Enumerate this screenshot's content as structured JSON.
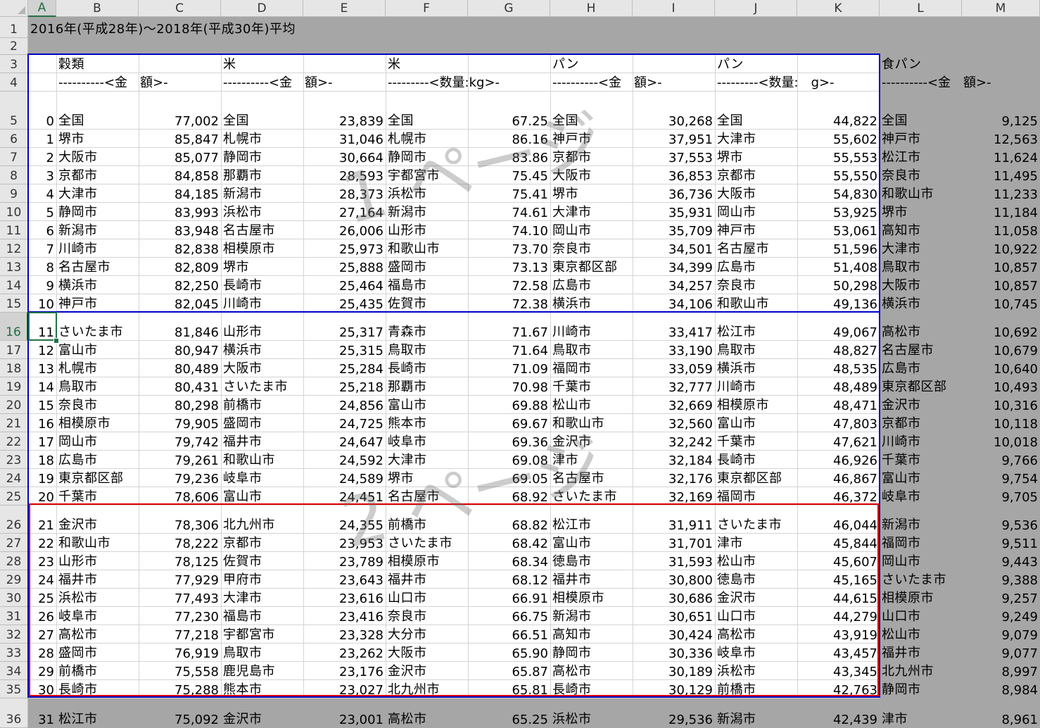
{
  "columns": [
    "A",
    "B",
    "C",
    "D",
    "E",
    "F",
    "G",
    "H",
    "I",
    "J",
    "K",
    "L",
    "M"
  ],
  "selected_column": "A",
  "selected_row": 16,
  "title": "2016年(平成28年)～2018年(平成30年)平均",
  "groups": [
    {
      "name": "穀類",
      "sub": "----------<金　額>-"
    },
    {
      "name": "米",
      "sub": "----------<金　額>-"
    },
    {
      "name": "米",
      "sub": "---------<数量:kg>-"
    },
    {
      "name": "パン",
      "sub": "----------<金　額>-"
    },
    {
      "name": "パン",
      "sub": "---------<数量:　g>-"
    },
    {
      "name": "食パン",
      "sub": "----------<金　額>-"
    }
  ],
  "rows": [
    [
      0,
      "全国",
      "77,002",
      "全国",
      "23,839",
      "全国",
      "67.25",
      "全国",
      "30,268",
      "全国",
      "44,822",
      "全国",
      "9,125"
    ],
    [
      1,
      "堺市",
      "85,847",
      "札幌市",
      "31,046",
      "札幌市",
      "86.16",
      "神戸市",
      "37,951",
      "大津市",
      "55,602",
      "神戸市",
      "12,563"
    ],
    [
      2,
      "大阪市",
      "85,077",
      "静岡市",
      "30,664",
      "静岡市",
      "83.86",
      "京都市",
      "37,553",
      "堺市",
      "55,553",
      "松江市",
      "11,624"
    ],
    [
      3,
      "京都市",
      "84,858",
      "那覇市",
      "28,593",
      "宇都宮市",
      "75.45",
      "大阪市",
      "36,853",
      "京都市",
      "55,550",
      "奈良市",
      "11,495"
    ],
    [
      4,
      "大津市",
      "84,185",
      "新潟市",
      "28,373",
      "浜松市",
      "75.41",
      "堺市",
      "36,736",
      "大阪市",
      "54,830",
      "和歌山市",
      "11,233"
    ],
    [
      5,
      "静岡市",
      "83,993",
      "浜松市",
      "27,164",
      "新潟市",
      "74.61",
      "大津市",
      "35,931",
      "岡山市",
      "53,925",
      "堺市",
      "11,184"
    ],
    [
      6,
      "新潟市",
      "83,948",
      "名古屋市",
      "26,006",
      "山形市",
      "74.10",
      "岡山市",
      "35,709",
      "神戸市",
      "53,061",
      "高知市",
      "11,058"
    ],
    [
      7,
      "川崎市",
      "82,838",
      "相模原市",
      "25,973",
      "和歌山市",
      "73.70",
      "奈良市",
      "34,501",
      "名古屋市",
      "51,596",
      "大津市",
      "10,922"
    ],
    [
      8,
      "名古屋市",
      "82,809",
      "堺市",
      "25,888",
      "盛岡市",
      "73.13",
      "東京都区部",
      "34,399",
      "広島市",
      "51,408",
      "鳥取市",
      "10,857"
    ],
    [
      9,
      "横浜市",
      "82,250",
      "長崎市",
      "25,464",
      "福島市",
      "72.58",
      "広島市",
      "34,257",
      "奈良市",
      "50,298",
      "大阪市",
      "10,857"
    ],
    [
      10,
      "神戸市",
      "82,045",
      "川崎市",
      "25,435",
      "佐賀市",
      "72.38",
      "横浜市",
      "34,106",
      "和歌山市",
      "49,136",
      "横浜市",
      "10,745"
    ],
    [
      11,
      "さいたま市",
      "81,846",
      "山形市",
      "25,317",
      "青森市",
      "71.67",
      "川崎市",
      "33,417",
      "松江市",
      "49,067",
      "高松市",
      "10,692"
    ],
    [
      12,
      "富山市",
      "80,947",
      "横浜市",
      "25,315",
      "鳥取市",
      "71.64",
      "鳥取市",
      "33,190",
      "鳥取市",
      "48,827",
      "名古屋市",
      "10,679"
    ],
    [
      13,
      "札幌市",
      "80,489",
      "大阪市",
      "25,284",
      "長崎市",
      "71.09",
      "福岡市",
      "33,059",
      "横浜市",
      "48,535",
      "広島市",
      "10,640"
    ],
    [
      14,
      "鳥取市",
      "80,431",
      "さいたま市",
      "25,218",
      "那覇市",
      "70.98",
      "千葉市",
      "32,777",
      "川崎市",
      "48,489",
      "東京都区部",
      "10,493"
    ],
    [
      15,
      "奈良市",
      "80,298",
      "前橋市",
      "24,856",
      "富山市",
      "69.88",
      "松山市",
      "32,669",
      "相模原市",
      "48,471",
      "金沢市",
      "10,316"
    ],
    [
      16,
      "相模原市",
      "79,905",
      "盛岡市",
      "24,725",
      "熊本市",
      "69.67",
      "和歌山市",
      "32,560",
      "富山市",
      "47,803",
      "京都市",
      "10,118"
    ],
    [
      17,
      "岡山市",
      "79,742",
      "福井市",
      "24,647",
      "岐阜市",
      "69.36",
      "金沢市",
      "32,242",
      "千葉市",
      "47,621",
      "川崎市",
      "10,018"
    ],
    [
      18,
      "広島市",
      "79,261",
      "和歌山市",
      "24,592",
      "大津市",
      "69.08",
      "津市",
      "32,184",
      "長崎市",
      "46,926",
      "千葉市",
      "9,766"
    ],
    [
      19,
      "東京都区部",
      "79,236",
      "岐阜市",
      "24,589",
      "堺市",
      "69.05",
      "名古屋市",
      "32,176",
      "東京都区部",
      "46,867",
      "富山市",
      "9,754"
    ],
    [
      20,
      "千葉市",
      "78,606",
      "富山市",
      "24,451",
      "名古屋市",
      "68.92",
      "さいたま市",
      "32,169",
      "福岡市",
      "46,372",
      "岐阜市",
      "9,705"
    ],
    [
      21,
      "金沢市",
      "78,306",
      "北九州市",
      "24,355",
      "前橋市",
      "68.82",
      "松江市",
      "31,911",
      "さいたま市",
      "46,044",
      "新潟市",
      "9,536"
    ],
    [
      22,
      "和歌山市",
      "78,222",
      "京都市",
      "23,953",
      "さいたま市",
      "68.42",
      "富山市",
      "31,701",
      "津市",
      "45,844",
      "福岡市",
      "9,511"
    ],
    [
      23,
      "山形市",
      "78,125",
      "佐賀市",
      "23,789",
      "相模原市",
      "68.34",
      "徳島市",
      "31,593",
      "松山市",
      "45,607",
      "岡山市",
      "9,443"
    ],
    [
      24,
      "福井市",
      "77,929",
      "甲府市",
      "23,643",
      "福井市",
      "68.12",
      "福井市",
      "30,800",
      "徳島市",
      "45,165",
      "さいたま市",
      "9,388"
    ],
    [
      25,
      "浜松市",
      "77,493",
      "大津市",
      "23,616",
      "山口市",
      "66.91",
      "相模原市",
      "30,686",
      "金沢市",
      "44,615",
      "相模原市",
      "9,257"
    ],
    [
      26,
      "岐阜市",
      "77,230",
      "福島市",
      "23,416",
      "奈良市",
      "66.75",
      "新潟市",
      "30,651",
      "山口市",
      "44,279",
      "山口市",
      "9,249"
    ],
    [
      27,
      "高松市",
      "77,218",
      "宇都宮市",
      "23,328",
      "大分市",
      "66.51",
      "高知市",
      "30,424",
      "高松市",
      "43,919",
      "松山市",
      "9,079"
    ],
    [
      28,
      "盛岡市",
      "76,919",
      "鳥取市",
      "23,262",
      "大阪市",
      "65.90",
      "静岡市",
      "30,336",
      "岐阜市",
      "43,457",
      "福井市",
      "9,077"
    ],
    [
      29,
      "前橋市",
      "75,558",
      "鹿児島市",
      "23,176",
      "金沢市",
      "65.87",
      "高松市",
      "30,189",
      "浜松市",
      "43,345",
      "北九州市",
      "8,997"
    ],
    [
      30,
      "長崎市",
      "75,288",
      "熊本市",
      "23,027",
      "北九州市",
      "65.81",
      "長崎市",
      "30,129",
      "前橋市",
      "42,763",
      "静岡市",
      "8,984"
    ],
    [
      31,
      "松江市",
      "75,092",
      "金沢市",
      "23,001",
      "高松市",
      "65.25",
      "浜松市",
      "29,536",
      "新潟市",
      "42,439",
      "津市",
      "8,961"
    ]
  ],
  "watermarks": [
    "1 ページ",
    "2 ページ"
  ],
  "colors": {
    "sheet_bg": "#a6a6a6",
    "print_area": "#ffffff",
    "page_border_blue": "#0000c8",
    "page_border_red": "#e00000",
    "selection": "#217346"
  }
}
